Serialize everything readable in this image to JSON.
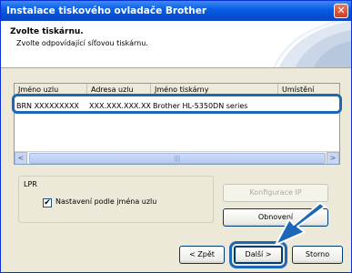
{
  "window": {
    "title": "Instalace tiskového ovladače Brother",
    "close_glyph": "✕"
  },
  "header": {
    "title": "Zvolte tiskárnu.",
    "subtitle": "Zvolte odpovídající síťovou tiskárnu."
  },
  "list": {
    "columns": [
      "Jméno uzlu",
      "Adresa uzlu",
      "Jméno tiskárny",
      "Umístění"
    ],
    "rows": [
      {
        "node_name": "BRN XXXXXXXXX",
        "node_address": "XXX.XXX.XXX.XX",
        "printer_name": "Brother HL-5350DN series",
        "location": ""
      }
    ],
    "scroll_left": "<",
    "scroll_right": ">",
    "scroll_grip": "|||"
  },
  "lpr": {
    "group_label": "LPR",
    "checkbox_label": "Nastavení podle jména uzlu",
    "checked": true,
    "check_glyph": "✔"
  },
  "buttons": {
    "configure_ip": "Konfigurace IP",
    "refresh": "Obnovení",
    "back": "< Zpět",
    "next": "Další >",
    "cancel": "Storno"
  },
  "colors": {
    "accent": "#1c68b7",
    "titlebar": "#0a5fe6",
    "window_bg": "#ece9d8"
  },
  "icons": {
    "close": "close-icon",
    "check": "check-icon",
    "pointer": "arrow-pointer-icon"
  }
}
